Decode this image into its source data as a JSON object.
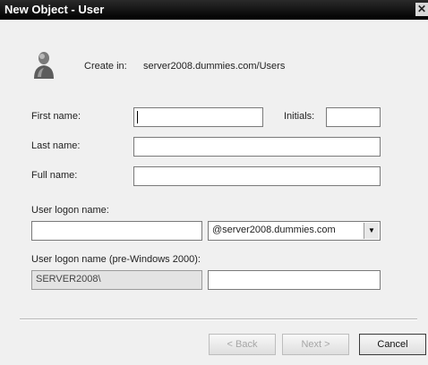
{
  "window": {
    "title": "New Object - User",
    "close_glyph": "✕"
  },
  "header": {
    "icon": "user-icon",
    "create_in_label": "Create in:",
    "create_in_path": "server2008.dummies.com/Users"
  },
  "form": {
    "first_name_label": "First name:",
    "first_name_value": "",
    "initials_label": "Initials:",
    "initials_value": "",
    "last_name_label": "Last name:",
    "last_name_value": "",
    "full_name_label": "Full name:",
    "full_name_value": "",
    "logon_label": "User logon name:",
    "logon_value": "",
    "domain_selected": "@server2008.dummies.com",
    "prewin_label": "User logon name (pre-Windows 2000):",
    "prewin_domain": "SERVER2008\\",
    "prewin_value": ""
  },
  "buttons": {
    "back": "< Back",
    "next": "Next >",
    "cancel": "Cancel"
  }
}
